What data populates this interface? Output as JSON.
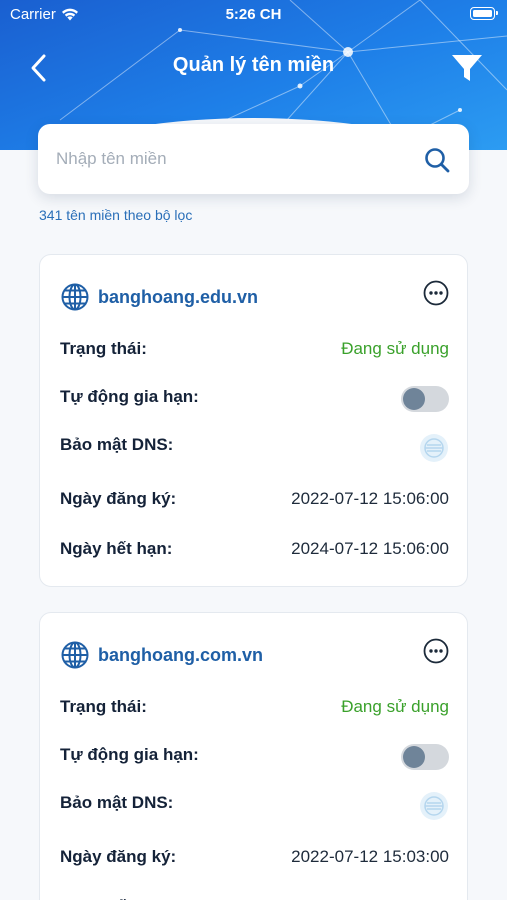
{
  "status_bar": {
    "carrier": "Carrier",
    "time": "5:26 CH"
  },
  "header": {
    "title": "Quản lý tên miền",
    "back_icon": "chevron-left-icon",
    "filter_icon": "filter-icon"
  },
  "search": {
    "placeholder": "Nhập tên miền",
    "value": "",
    "icon": "search-icon"
  },
  "result_count": "341 tên miền theo bộ lọc",
  "labels": {
    "status": "Trạng thái:",
    "auto_renew": "Tự động gia hạn:",
    "dns": "Bảo mật DNS:",
    "registered": "Ngày đăng ký:",
    "expires": "Ngày hết hạn:"
  },
  "domains": [
    {
      "name": "banghoang.edu.vn",
      "status": "Đang sử dụng",
      "auto_renew": false,
      "registered": "2022-07-12 15:06:00",
      "expires": "2024-07-12 15:06:00"
    },
    {
      "name": "banghoang.com.vn",
      "status": "Đang sử dụng",
      "auto_renew": false,
      "registered": "2022-07-12 15:03:00",
      "expires": ""
    }
  ],
  "colors": {
    "header": "#1e7fe8",
    "link": "#1f5fa6",
    "status_active": "#3aa12b"
  }
}
